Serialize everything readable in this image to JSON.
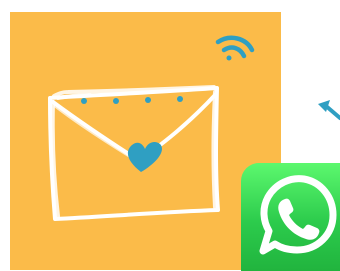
{
  "colors": {
    "app_background": "#fbbb49",
    "sketch_stroke": "#ffffff",
    "accent_blue": "#2f9fc2",
    "whatsapp_green": "#2ccb4c"
  },
  "icons": {
    "envelope": "envelope-sketch-icon",
    "heart_seal": "heart-icon",
    "signal": "wifi-signal-icon",
    "arrow": "arrow-icon",
    "whatsapp": "whatsapp-logo-icon"
  }
}
